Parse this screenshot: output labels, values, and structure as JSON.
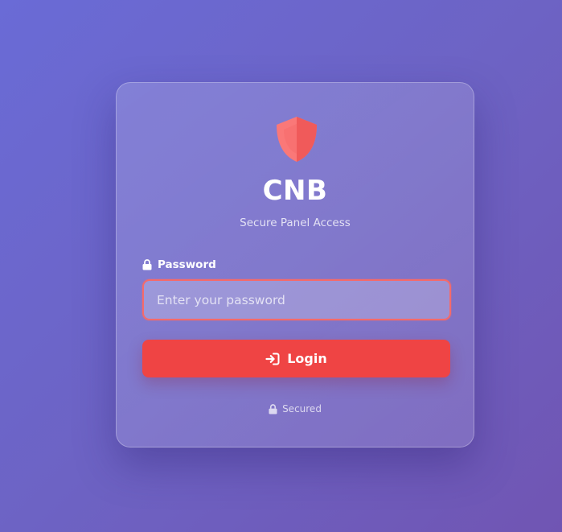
{
  "brand": {
    "title": "CNB",
    "subtitle": "Secure Panel Access",
    "logo_icon": "shield-icon",
    "logo_color": "#f87171"
  },
  "form": {
    "password_label": "Password",
    "password_label_icon": "lock-icon",
    "password_placeholder": "Enter your password",
    "password_value": "",
    "input_border_color": "#f56a6a"
  },
  "actions": {
    "login_label": "Login",
    "login_icon": "sign-in-icon",
    "login_color": "#ef4444"
  },
  "footer": {
    "status_text": "Secured",
    "status_icon": "lock-icon"
  },
  "theme": {
    "background_start": "#6a6bd6",
    "background_end": "#7055b3"
  }
}
